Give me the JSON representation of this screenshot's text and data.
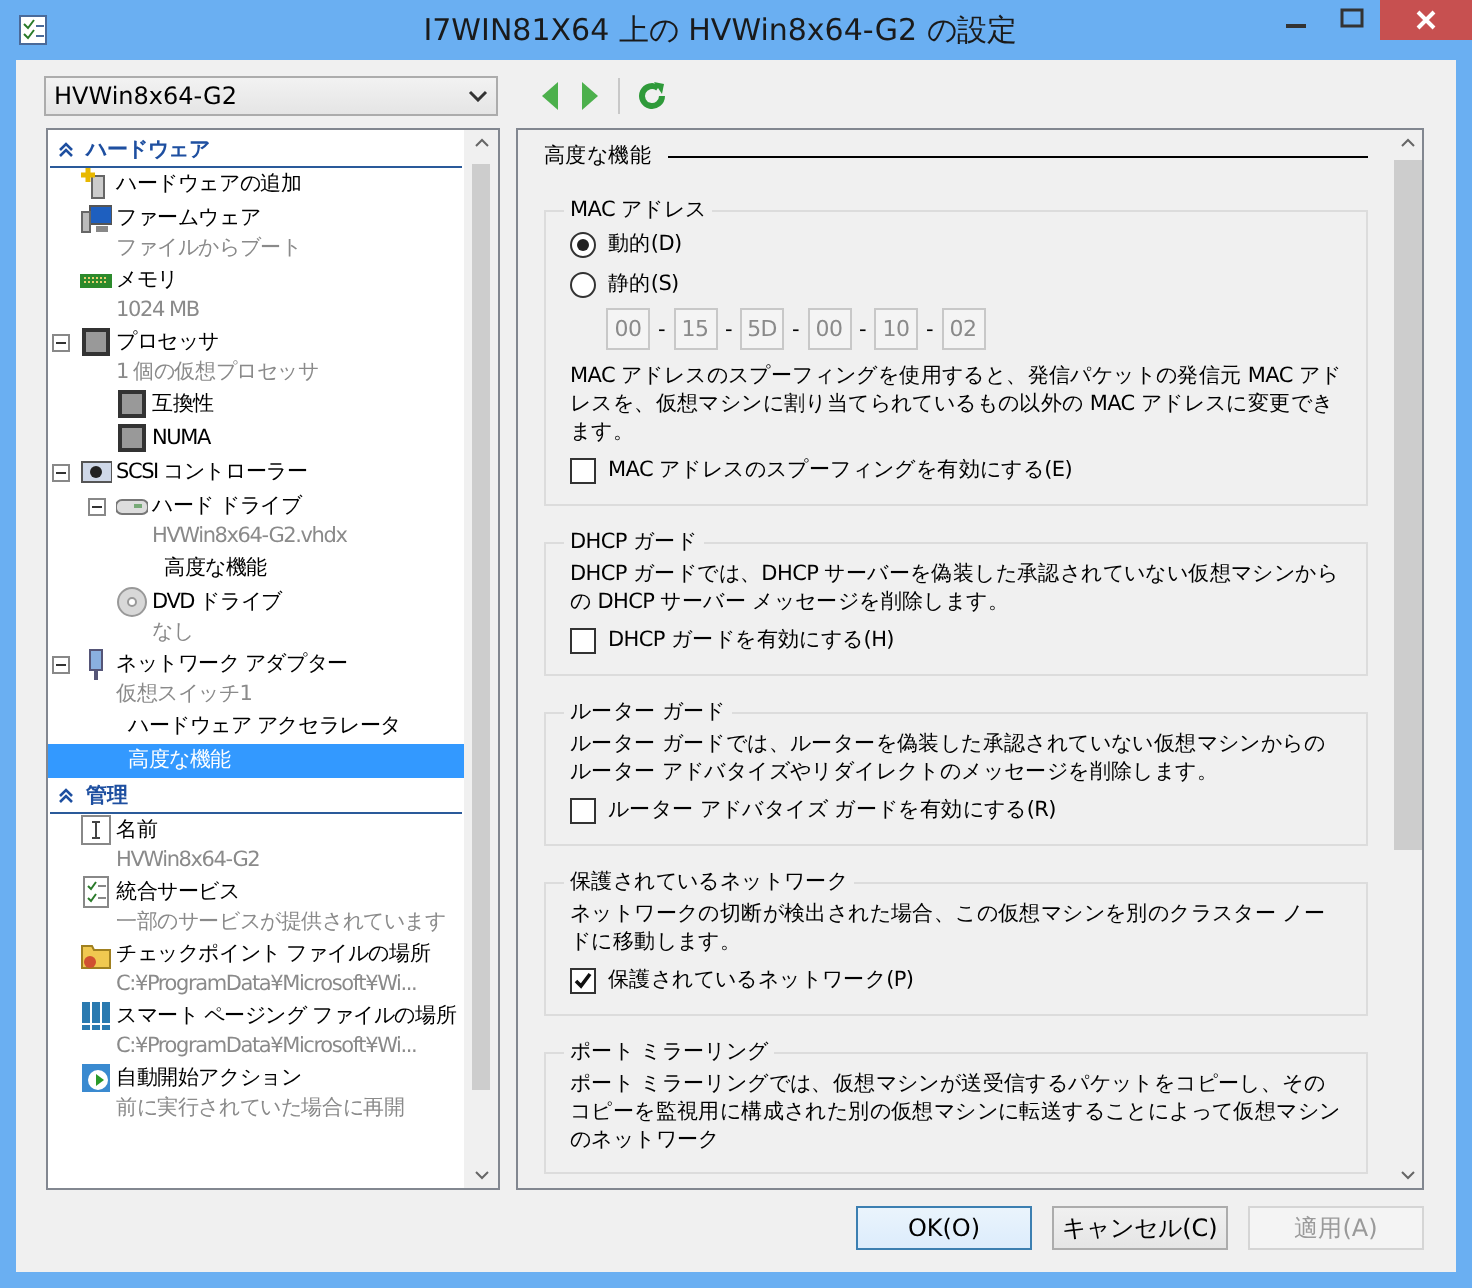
{
  "window": {
    "title": "I7WIN81X64 上の HVWin8x64-G2 の設定"
  },
  "toolbar": {
    "vm_selector": {
      "value": "HVWin8x64-G2"
    }
  },
  "sidebar": {
    "sections": [
      {
        "title": "ハードウェア",
        "expanded": true,
        "items": [
          {
            "label": "ハードウェアの追加",
            "selected": false
          },
          {
            "label": "ファームウェア",
            "sublabel": "ファイルからブート",
            "selected": false
          },
          {
            "label": "メモリ",
            "sublabel": "1024 MB",
            "selected": false
          },
          {
            "label": "プロセッサ",
            "sublabel": "1 個の仮想プロセッサ",
            "expanded": true,
            "selected": false,
            "children": [
              {
                "label": "互換性",
                "selected": false
              },
              {
                "label": "NUMA",
                "selected": false
              }
            ]
          },
          {
            "label": "SCSI コントローラー",
            "expanded": true,
            "selected": false,
            "children": [
              {
                "label": "ハード ドライブ",
                "sublabel": "HVWin8x64-G2.vhdx",
                "expanded": true,
                "selected": false,
                "children": [
                  {
                    "label": "高度な機能",
                    "selected": false
                  }
                ]
              },
              {
                "label": "DVD ドライブ",
                "sublabel": "なし",
                "selected": false
              }
            ]
          },
          {
            "label": "ネットワーク アダプター",
            "sublabel": "仮想スイッチ1",
            "expanded": true,
            "selected": false,
            "children": [
              {
                "label": "ハードウェア アクセラレータ",
                "selected": false
              },
              {
                "label": "高度な機能",
                "selected": true
              }
            ]
          }
        ]
      },
      {
        "title": "管理",
        "expanded": true,
        "items": [
          {
            "label": "名前",
            "sublabel": "HVWin8x64-G2",
            "selected": false
          },
          {
            "label": "統合サービス",
            "sublabel": "一部のサービスが提供されています",
            "selected": false
          },
          {
            "label": "チェックポイント ファイルの場所",
            "sublabel": "C:¥ProgramData¥Microsoft¥Wi...",
            "selected": false
          },
          {
            "label": "スマート ページング ファイルの場所",
            "sublabel": "C:¥ProgramData¥Microsoft¥Wi...",
            "selected": false
          },
          {
            "label": "自動開始アクション",
            "sublabel": "前に実行されていた場合に再開",
            "selected": false
          }
        ]
      }
    ]
  },
  "panel": {
    "heading": "高度な機能",
    "groups": [
      {
        "title": "MAC アドレス",
        "items": [
          {
            "kind": "radio",
            "label": "動的(D)",
            "selected": true
          },
          {
            "kind": "radio",
            "label": "静的(S)",
            "selected": false
          },
          {
            "kind": "mac",
            "disabled": true,
            "separator": "-",
            "octets": [
              "00",
              "15",
              "5D",
              "00",
              "10",
              "02"
            ]
          },
          {
            "kind": "text",
            "text": "MAC アドレスのスプーフィングを使用すると、発信パケットの発信元 MAC アドレスを、仮想マシンに割り当てられているもの以外の MAC アドレスに変更できます。"
          },
          {
            "kind": "checkbox",
            "label": "MAC アドレスのスプーフィングを有効にする(E)",
            "checked": false
          }
        ]
      },
      {
        "title": "DHCP ガード",
        "items": [
          {
            "kind": "text",
            "text": "DHCP ガードでは、DHCP サーバーを偽装した承認されていない仮想マシンからの DHCP サーバー メッセージを削除します。"
          },
          {
            "kind": "checkbox",
            "label": "DHCP ガードを有効にする(H)",
            "checked": false
          }
        ]
      },
      {
        "title": "ルーター ガード",
        "items": [
          {
            "kind": "text",
            "text": "ルーター ガードでは、ルーターを偽装した承認されていない仮想マシンからのルーター アドバタイズやリダイレクトのメッセージを削除します。"
          },
          {
            "kind": "checkbox",
            "label": "ルーター アドバタイズ ガードを有効にする(R)",
            "checked": false
          }
        ]
      },
      {
        "title": "保護されているネットワーク",
        "items": [
          {
            "kind": "text",
            "text": "ネットワークの切断が検出された場合、この仮想マシンを別のクラスター ノードに移動します。"
          },
          {
            "kind": "checkbox",
            "label": "保護されているネットワーク(P)",
            "checked": true
          }
        ]
      },
      {
        "title": "ポート ミラーリング",
        "items": [
          {
            "kind": "text",
            "text": "ポート ミラーリングでは、仮想マシンが送受信するパケットをコピーし、そのコピーを監視用に構成された別の仮想マシンに転送することによって仮想マシンのネットワーク"
          }
        ]
      }
    ]
  },
  "buttons": [
    {
      "label": "OK(O)",
      "disabled": false,
      "default": true
    },
    {
      "label": "キャンセル(C)",
      "disabled": false,
      "default": false
    },
    {
      "label": "適用(A)",
      "disabled": true,
      "default": false
    }
  ]
}
